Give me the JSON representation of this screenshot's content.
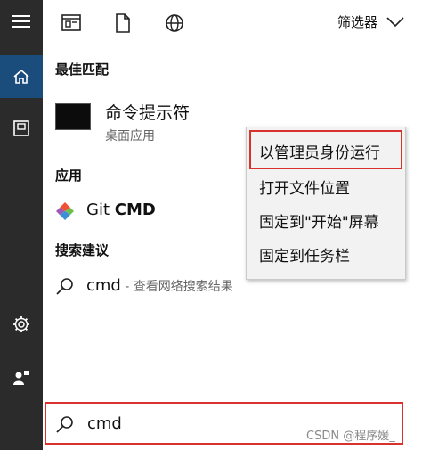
{
  "toolbar": {
    "filter_label": "筛选器"
  },
  "best_match": {
    "heading": "最佳匹配",
    "app_name": "命令提示符",
    "app_type": "桌面应用"
  },
  "apps": {
    "heading": "应用",
    "items": [
      {
        "prefix": "Git ",
        "bold": "CMD"
      }
    ]
  },
  "suggestions": {
    "heading": "搜索建议",
    "items": [
      {
        "term": "cmd",
        "rest": " - 查看网络搜索结果"
      }
    ]
  },
  "context_menu": {
    "items": [
      {
        "label": "以管理员身份运行"
      },
      {
        "label": "打开文件位置"
      },
      {
        "label": "固定到\"开始\"屏幕"
      },
      {
        "label": "固定到任务栏"
      }
    ]
  },
  "search": {
    "value": "cmd"
  },
  "watermark": "CSDN @程序媛_",
  "colors": {
    "accent": "#1a4d7c",
    "highlight_border": "#d9312c",
    "rail": "#2b2b2b"
  }
}
